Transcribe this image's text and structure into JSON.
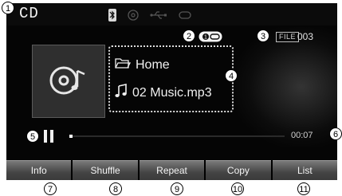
{
  "screen": {
    "source_title": "CD",
    "status_icons": [
      "bluetooth-icon",
      "disc-icon",
      "usb-icon",
      "aux-icon"
    ],
    "repeat_indicator": "repeat-icon",
    "file_label": "FILE",
    "file_number": "003",
    "folder_name": "Home",
    "track_name": "02 Music.mp3",
    "play_state": "paused",
    "progress_fraction": 0.01,
    "elapsed_time": "00:07",
    "menu": [
      {
        "label": "Info"
      },
      {
        "label": "Shuffle"
      },
      {
        "label": "Repeat"
      },
      {
        "label": "Copy"
      },
      {
        "label": "List"
      }
    ]
  },
  "callouts": [
    "1",
    "2",
    "3",
    "4",
    "5",
    "6",
    "7",
    "8",
    "9",
    "10",
    "11"
  ]
}
